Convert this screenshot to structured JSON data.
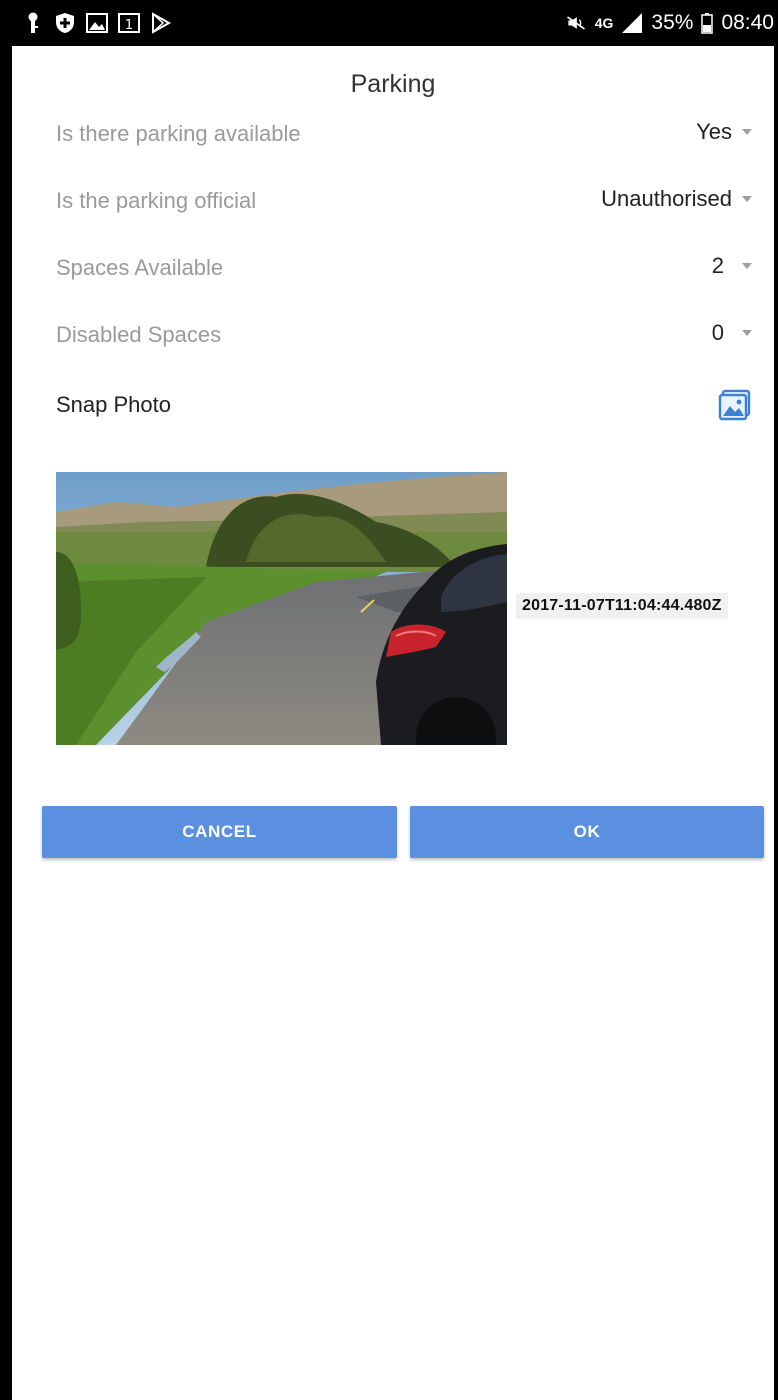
{
  "status_bar": {
    "network": "4G",
    "battery": "35%",
    "time": "08:40"
  },
  "dialog": {
    "title": "Parking",
    "fields": [
      {
        "label": "Is there parking available",
        "value": "Yes"
      },
      {
        "label": "Is the parking official",
        "value": "Unauthorised"
      },
      {
        "label": "Spaces Available",
        "value": "2"
      },
      {
        "label": "Disabled Spaces",
        "value": "0"
      }
    ],
    "snap_photo_label": "Snap Photo",
    "photo_timestamp": "2017-11-07T11:04:44.480Z",
    "cancel_label": "CANCEL",
    "ok_label": "OK"
  },
  "colors": {
    "button": "#5b8fe0",
    "photo_icon": "#3b82d6"
  }
}
